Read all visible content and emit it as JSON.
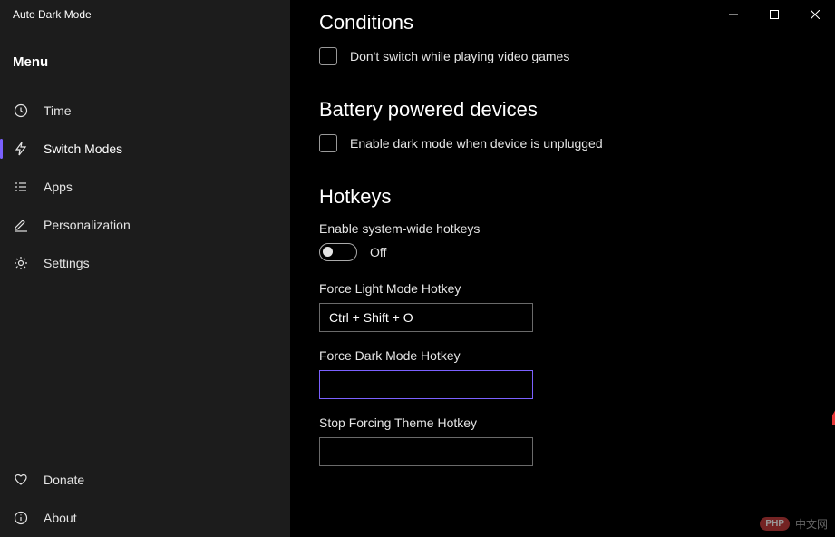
{
  "app_title": "Auto Dark Mode",
  "menu_header": "Menu",
  "nav": {
    "time": "Time",
    "switch_modes": "Switch Modes",
    "apps": "Apps",
    "personalization": "Personalization",
    "settings": "Settings",
    "donate": "Donate",
    "about": "About"
  },
  "sections": {
    "conditions": {
      "title": "Conditions",
      "video_games_label": "Don't switch while playing video games"
    },
    "battery": {
      "title": "Battery powered devices",
      "unplugged_label": "Enable dark mode when device is unplugged"
    },
    "hotkeys": {
      "title": "Hotkeys",
      "enable_label": "Enable system-wide hotkeys",
      "toggle_state": "Off",
      "light_label": "Force Light Mode Hotkey",
      "light_value": "Ctrl + Shift + O",
      "dark_label": "Force Dark Mode Hotkey",
      "dark_value": "",
      "stop_label": "Stop Forcing Theme Hotkey",
      "stop_value": ""
    }
  },
  "watermark": {
    "badge": "PHP",
    "text": "中文网"
  }
}
